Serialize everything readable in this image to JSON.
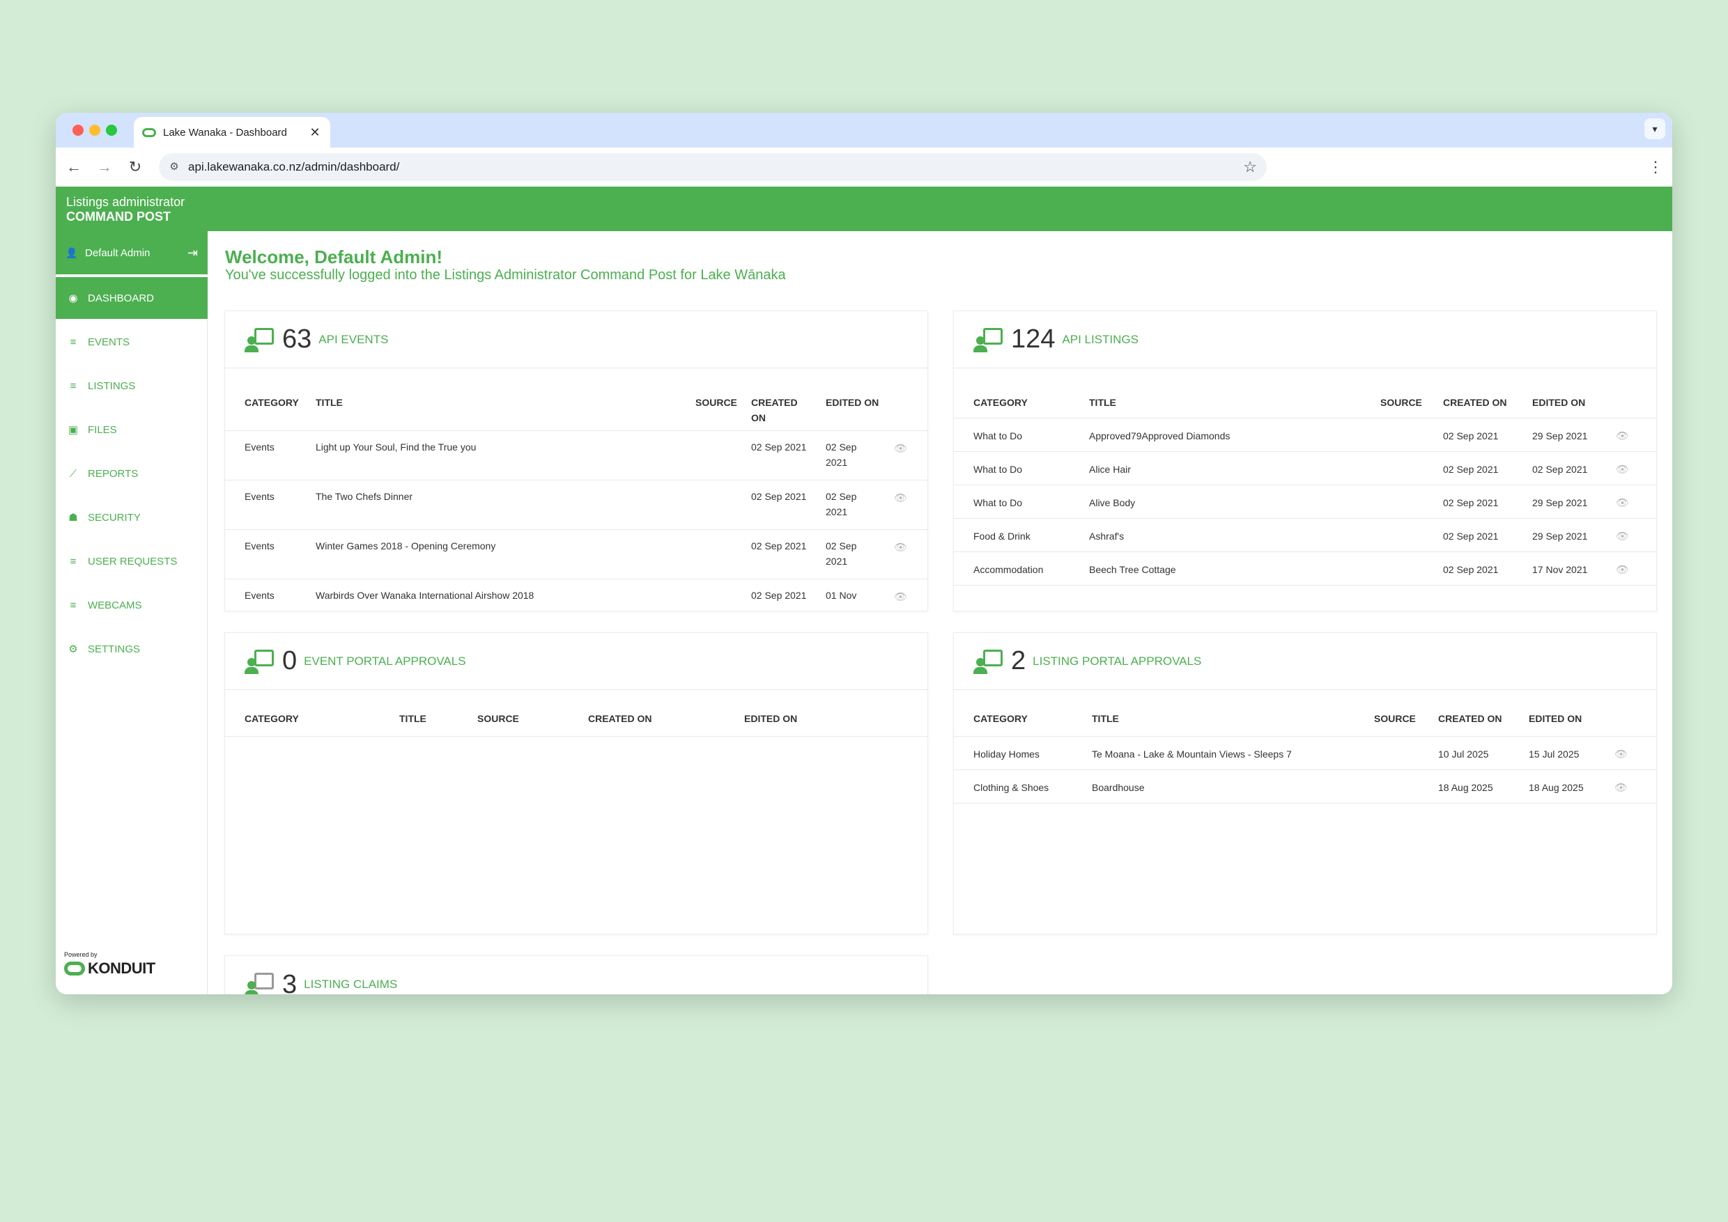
{
  "browser": {
    "tab_title": "Lake Wanaka - Dashboard",
    "tab_close": "✕",
    "url": "api.lakewanaka.co.nz/admin/dashboard/"
  },
  "header": {
    "subtitle": "Listings administrator",
    "title": "COMMAND POST"
  },
  "sidebar": {
    "user_name": "Default Admin",
    "items": [
      {
        "label": "DASHBOARD",
        "icon": "dashboard-icon"
      },
      {
        "label": "EVENTS",
        "icon": "database-icon"
      },
      {
        "label": "LISTINGS",
        "icon": "database-icon"
      },
      {
        "label": "FILES",
        "icon": "image-icon"
      },
      {
        "label": "REPORTS",
        "icon": "chart-line-icon"
      },
      {
        "label": "SECURITY",
        "icon": "users-icon"
      },
      {
        "label": "USER REQUESTS",
        "icon": "database-icon"
      },
      {
        "label": "WEBCAMS",
        "icon": "database-icon"
      },
      {
        "label": "SETTINGS",
        "icon": "gear-icon"
      }
    ],
    "powered_by": "Powered by",
    "brand": "KONDUIT"
  },
  "welcome": {
    "title": "Welcome, Default Admin!",
    "subtitle": "You've successfully logged into the Listings Administrator Command Post for Lake Wānaka"
  },
  "api_events": {
    "count": "63",
    "label": "API EVENTS",
    "columns": [
      "CATEGORY",
      "TITLE",
      "SOURCE",
      "CREATED ON",
      "EDITED ON"
    ],
    "rows": [
      {
        "category": "Events",
        "title": "Light up Your Soul, Find the True you",
        "source": "",
        "created": "02 Sep 2021",
        "edited": "02 Sep 2021"
      },
      {
        "category": "Events",
        "title": "The Two Chefs Dinner",
        "source": "",
        "created": "02 Sep 2021",
        "edited": "02 Sep 2021"
      },
      {
        "category": "Events",
        "title": "Winter Games 2018 - Opening Ceremony",
        "source": "",
        "created": "02 Sep 2021",
        "edited": "02 Sep 2021"
      },
      {
        "category": "Events",
        "title": "Warbirds Over Wanaka International Airshow 2018",
        "source": "",
        "created": "02 Sep 2021",
        "edited": "01 Nov"
      }
    ]
  },
  "api_listings": {
    "count": "124",
    "label": "API LISTINGS",
    "columns": [
      "CATEGORY",
      "TITLE",
      "SOURCE",
      "CREATED ON",
      "EDITED ON"
    ],
    "rows": [
      {
        "category": "What to Do",
        "title": "Approved79Approved Diamonds",
        "source": "",
        "created": "02 Sep 2021",
        "edited": "29 Sep 2021"
      },
      {
        "category": "What to Do",
        "title": "Alice Hair",
        "source": "",
        "created": "02 Sep 2021",
        "edited": "02 Sep 2021"
      },
      {
        "category": "What to Do",
        "title": "Alive Body",
        "source": "",
        "created": "02 Sep 2021",
        "edited": "29 Sep 2021"
      },
      {
        "category": "Food & Drink",
        "title": "Ashraf's",
        "source": "",
        "created": "02 Sep 2021",
        "edited": "29 Sep 2021"
      },
      {
        "category": "Accommodation",
        "title": "Beech Tree Cottage",
        "source": "",
        "created": "02 Sep 2021",
        "edited": "17 Nov 2021"
      }
    ]
  },
  "event_portal": {
    "count": "0",
    "label": "EVENT PORTAL APPROVALS",
    "columns": [
      "CATEGORY",
      "TITLE",
      "SOURCE",
      "CREATED ON",
      "EDITED ON"
    ]
  },
  "listing_portal": {
    "count": "2",
    "label": "LISTING PORTAL APPROVALS",
    "columns": [
      "CATEGORY",
      "TITLE",
      "SOURCE",
      "CREATED ON",
      "EDITED ON"
    ],
    "rows": [
      {
        "category": "Holiday Homes",
        "title": "Te Moana - Lake & Mountain Views - Sleeps 7",
        "source": "",
        "created": "10 Jul 2025",
        "edited": "15 Jul 2025"
      },
      {
        "category": "Clothing & Shoes",
        "title": "Boardhouse",
        "source": "",
        "created": "18 Aug 2025",
        "edited": "18 Aug 2025"
      }
    ]
  },
  "listing_claims": {
    "count": "3",
    "label": "LISTING CLAIMS"
  },
  "colors": {
    "brand_green": "#4caf50",
    "page_bg": "#d2ecd5",
    "tab_strip": "#d3e3fd"
  }
}
